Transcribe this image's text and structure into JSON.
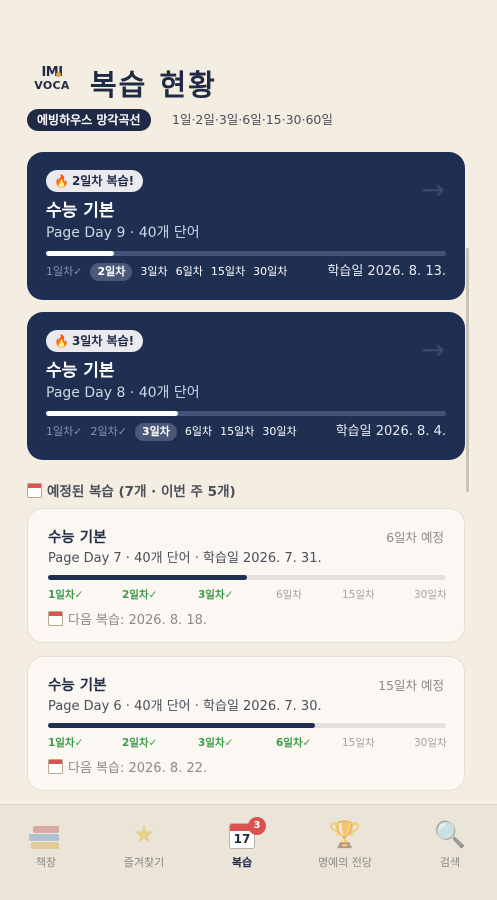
{
  "header": {
    "logo_top": "IMI",
    "logo_bottom": "VOCA",
    "title": "복습 현황",
    "curve_badge": "에빙하우스 망각곡선",
    "curve_intervals": "1일·2일·3일·6일·15·30·60일"
  },
  "due_reviews": [
    {
      "badge": "2일차 복습!",
      "title": "수능 기본",
      "subtitle": "Page Day 9 · 40개 단어",
      "progress": 0.17,
      "stages": [
        {
          "label": "1일차✓",
          "state": "done"
        },
        {
          "label": "2일차",
          "state": "current"
        },
        {
          "label": "3일차",
          "state": "todo"
        },
        {
          "label": "6일차",
          "state": "todo"
        },
        {
          "label": "15일차",
          "state": "todo"
        },
        {
          "label": "30일차",
          "state": "todo"
        }
      ],
      "study_date": "학습일 2026. 8. 13."
    },
    {
      "badge": "3일차 복습!",
      "title": "수능 기본",
      "subtitle": "Page Day 8 · 40개 단어",
      "progress": 0.33,
      "stages": [
        {
          "label": "1일차✓",
          "state": "done"
        },
        {
          "label": "2일차✓",
          "state": "done"
        },
        {
          "label": "3일차",
          "state": "current"
        },
        {
          "label": "6일차",
          "state": "todo"
        },
        {
          "label": "15일차",
          "state": "todo"
        },
        {
          "label": "30일차",
          "state": "todo"
        }
      ],
      "study_date": "학습일 2026. 8. 4."
    }
  ],
  "scheduled_section": {
    "title": "예정된 복습 (7개 · 이번 주 5개)"
  },
  "scheduled_reviews": [
    {
      "title": "수능 기본",
      "expected": "6일차 예정",
      "subtitle": "Page Day 7 · 40개 단어 · 학습일 2026. 7. 31.",
      "progress": 0.5,
      "stages": [
        {
          "label": "1일차✓",
          "state": "ok"
        },
        {
          "label": "2일차✓",
          "state": "ok"
        },
        {
          "label": "3일차✓",
          "state": "ok"
        },
        {
          "label": "6일차",
          "state": "todo"
        },
        {
          "label": "15일차",
          "state": "todo"
        },
        {
          "label": "30일차",
          "state": "todo"
        }
      ],
      "next_review": "다음 복습: 2026. 8. 18."
    },
    {
      "title": "수능 기본",
      "expected": "15일차 예정",
      "subtitle": "Page Day 6 · 40개 단어 · 학습일 2026. 7. 30.",
      "progress": 0.67,
      "stages": [
        {
          "label": "1일차✓",
          "state": "ok"
        },
        {
          "label": "2일차✓",
          "state": "ok"
        },
        {
          "label": "3일차✓",
          "state": "ok"
        },
        {
          "label": "6일차✓",
          "state": "ok"
        },
        {
          "label": "15일차",
          "state": "todo"
        },
        {
          "label": "30일차",
          "state": "todo"
        }
      ],
      "next_review": "다음 복습: 2026. 8. 22."
    }
  ],
  "tabbar": {
    "items": [
      {
        "label": "책장",
        "icon": "books-icon"
      },
      {
        "label": "즐겨찾기",
        "icon": "star-icon"
      },
      {
        "label": "복습",
        "icon": "calendar-icon",
        "badge": "3",
        "calendar_number": "17",
        "active": true
      },
      {
        "label": "명예의 전당",
        "icon": "trophy-icon"
      },
      {
        "label": "검색",
        "icon": "search-icon"
      }
    ]
  },
  "colors": {
    "background": "#f4ede1",
    "navy": "#1f2f52",
    "success": "#3c9a4a",
    "badge_red": "#d9534f"
  }
}
